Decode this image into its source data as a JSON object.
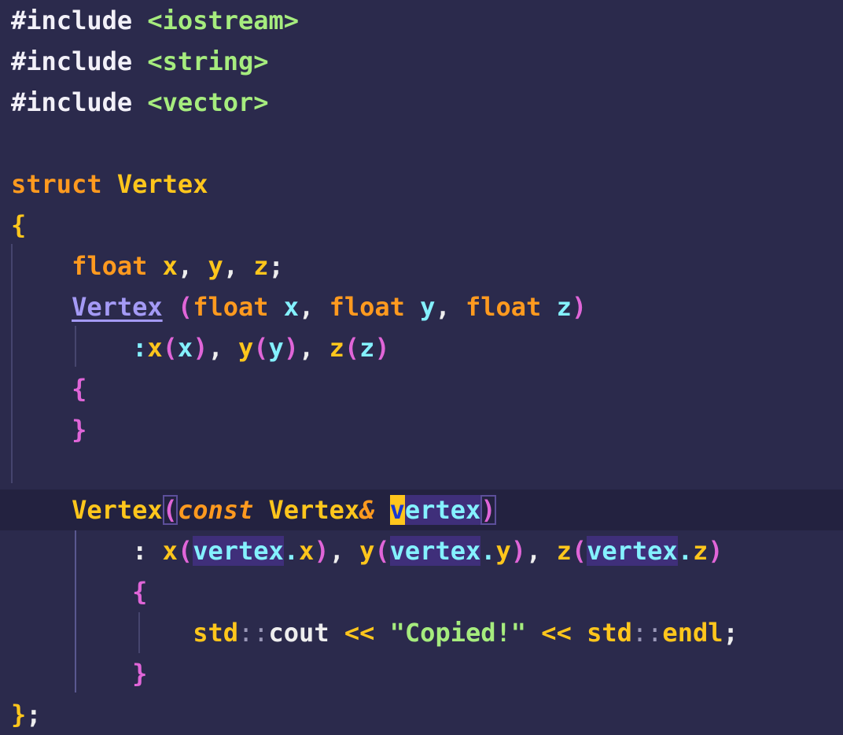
{
  "editor": {
    "language": "cpp",
    "cursor_line": 13,
    "colors": {
      "background": "#2b2a4c",
      "current_line": "#232240",
      "keyword": "#ff9a1f",
      "type": "#ffc61c",
      "variable": "#84f1ff",
      "string": "#a6ec7e",
      "bracket": "#e065d8",
      "function": "#a49af5",
      "cursor": "#ffc61c"
    },
    "lines": {
      "l1": {
        "t1": "#include",
        "t2": " ",
        "t3": "<iostream>"
      },
      "l2": {
        "t1": "#include",
        "t2": " ",
        "t3": "<string>"
      },
      "l3": {
        "t1": "#include",
        "t2": " ",
        "t3": "<vector>"
      },
      "l5": {
        "t1": "struct",
        "t2": " ",
        "t3": "Vertex"
      },
      "l6": {
        "t1": "{"
      },
      "l7": {
        "ind": "    ",
        "t1": "float",
        "t2": " ",
        "t3": "x",
        "t4": ", ",
        "t5": "y",
        "t6": ", ",
        "t7": "z",
        "t8": ";"
      },
      "l8": {
        "ind": "    ",
        "t1": "Vertex",
        "t2": " ",
        "t3": "(",
        "t4": "float",
        "t5": " ",
        "t6": "x",
        "t7": ", ",
        "t8": "float",
        "t9": " ",
        "t10": "y",
        "t11": ", ",
        "t12": "float",
        "t13": " ",
        "t14": "z",
        "t15": ")"
      },
      "l9": {
        "ind": "        ",
        "t1": ":",
        "t2": "x",
        "t3": "(",
        "t4": "x",
        "t5": ")",
        "t6": ", ",
        "t7": "y",
        "t8": "(",
        "t9": "y",
        "t10": ")",
        "t11": ", ",
        "t12": "z",
        "t13": "(",
        "t14": "z",
        "t15": ")"
      },
      "l10": {
        "ind": "    ",
        "t1": "{"
      },
      "l11": {
        "ind": "    ",
        "t1": "}"
      },
      "l13": {
        "ind": "    ",
        "t1": "Vertex",
        "t2": "(",
        "t3": "const",
        "t4": " ",
        "t5": "Vertex",
        "t6": "&",
        "t7": " ",
        "t8": "v",
        "t9": "ertex",
        "t10": ")"
      },
      "l14": {
        "ind": "        ",
        "t1": ":",
        "t2": " ",
        "t3": "x",
        "t4": "(",
        "t5": "vertex",
        "t6": ".",
        "t7": "x",
        "t8": ")",
        "t9": ", ",
        "t10": "y",
        "t11": "(",
        "t12": "vertex",
        "t13": ".",
        "t14": "y",
        "t15": ")",
        "t16": ", ",
        "t17": "z",
        "t18": "(",
        "t19": "vertex",
        "t20": ".",
        "t21": "z",
        "t22": ")"
      },
      "l15": {
        "ind": "        ",
        "t1": "{"
      },
      "l16": {
        "ind": "            ",
        "t1": "std",
        "t2": "::",
        "t3": "cout",
        "t4": " ",
        "t5": "<<",
        "t6": " ",
        "t7": "\"Copied!\"",
        "t8": " ",
        "t9": "<<",
        "t10": " ",
        "t11": "std",
        "t12": "::",
        "t13": "endl",
        "t14": ";"
      },
      "l17": {
        "ind": "        ",
        "t1": "}"
      },
      "l18": {
        "t1": "}",
        "t2": ";"
      }
    }
  }
}
